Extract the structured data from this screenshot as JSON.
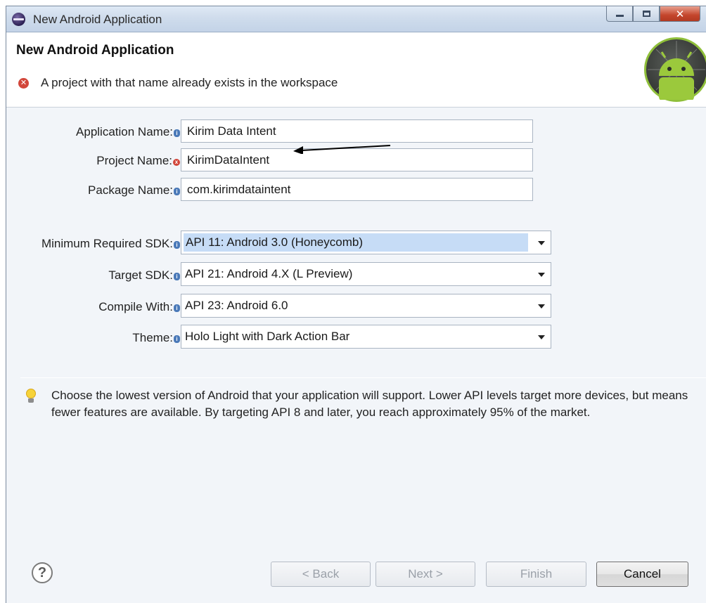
{
  "window": {
    "title": "New Android Application"
  },
  "banner": {
    "heading": "New Android Application",
    "message": "A project with that name already exists in the workspace"
  },
  "form": {
    "application_name": {
      "label": "Application Name:",
      "value": "Kirim Data Intent",
      "status": "info"
    },
    "project_name": {
      "label": "Project Name:",
      "value": "KirimDataIntent",
      "status": "error"
    },
    "package_name": {
      "label": "Package Name:",
      "value": "com.kirimdataintent",
      "status": "info"
    },
    "min_sdk": {
      "label": "Minimum Required SDK:",
      "value": "API 11: Android 3.0 (Honeycomb)"
    },
    "target_sdk": {
      "label": "Target SDK:",
      "value": "API 21: Android 4.X (L Preview)"
    },
    "compile_with": {
      "label": "Compile With:",
      "value": "API 23: Android 6.0"
    },
    "theme": {
      "label": "Theme:",
      "value": "Holo Light with Dark Action Bar"
    }
  },
  "hint": "Choose the lowest version of Android that your application will support. Lower API levels target more devices, but means fewer features are available. By targeting API 8 and later, you reach approximately 95% of the market.",
  "footer": {
    "back_label": "< Back",
    "next_label": "Next >",
    "finish_label": "Finish",
    "cancel_label": "Cancel"
  },
  "colors": {
    "error": "#d2463a",
    "info": "#4a79b8",
    "selection": "#c6dcf6"
  },
  "icons": [
    "eclipse-app-icon",
    "minimize-icon",
    "maximize-icon",
    "close-icon",
    "error-icon",
    "info-icon",
    "android-logo",
    "lightbulb-icon",
    "help-icon"
  ]
}
